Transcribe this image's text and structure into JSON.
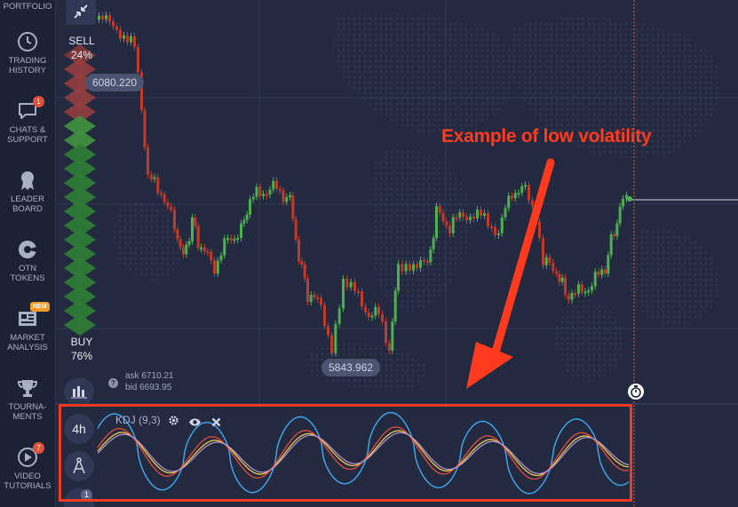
{
  "sidebar": {
    "portfolio": "PORTFOLIO",
    "items": [
      {
        "label1": "TRADING",
        "label2": "HISTORY",
        "icon": "clock-history-icon",
        "badge": ""
      },
      {
        "label1": "CHATS &",
        "label2": "SUPPORT",
        "icon": "chat-icon",
        "badge": "1"
      },
      {
        "label1": "LEADER",
        "label2": "BOARD",
        "icon": "medal-icon",
        "badge": ""
      },
      {
        "label1": "OTN",
        "label2": "TOKENS",
        "icon": "token-icon",
        "badge": ""
      },
      {
        "label1": "MARKET",
        "label2": "ANALYSIS",
        "icon": "newspaper-icon",
        "badge": "NEW"
      },
      {
        "label1": "TOURNA-",
        "label2": "MENTS",
        "icon": "trophy-icon",
        "badge": ""
      },
      {
        "label1": "VIDEO",
        "label2": "TUTORIALS",
        "icon": "play-icon",
        "badge": "7"
      }
    ]
  },
  "trade": {
    "sell_label": "SELL",
    "sell_pct": "24%",
    "buy_label": "BUY",
    "buy_pct": "76%",
    "ask": "ask 6710.21",
    "bid": "bid 6693.95"
  },
  "chart": {
    "high_price": "6080.220",
    "low_price": "5843.962",
    "timeframe": "4h",
    "indicator_count": "1",
    "indicator_label": "KDJ (9,3)",
    "annotation": "Example of low volatility",
    "colors": {
      "bull": "#4caf50",
      "bear": "#c0392b",
      "k": "#3fa9f5",
      "d": "#f2c94c",
      "j": "#e74c3c",
      "accent": "#ef3a22"
    }
  }
}
